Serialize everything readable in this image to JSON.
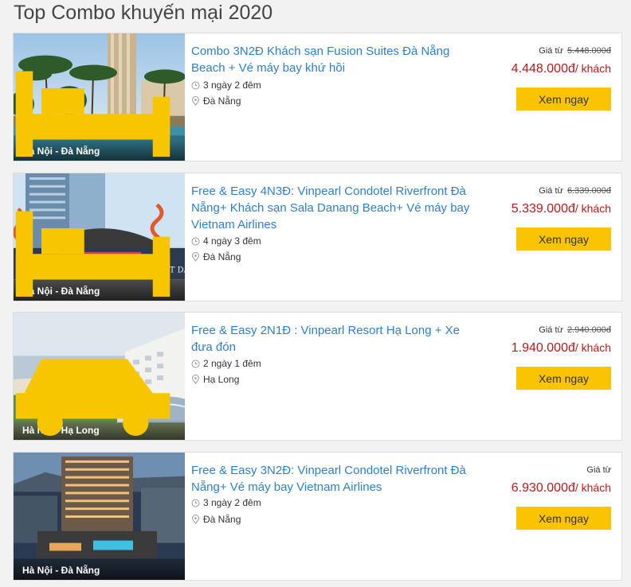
{
  "page": {
    "title": "Top Combo khuyến mại 2020"
  },
  "deals": [
    {
      "title": "Combo 3N2Đ Khách sạn Fusion Suites Đà Nẵng Beach + Vé máy bay khứ hồi",
      "duration": "3 ngày 2 đêm",
      "location": "Đà Nẵng",
      "route": "Hà Nội - Đà Nẵng",
      "price_from_label": "Giá từ",
      "original_price": "5.448.000đ",
      "price": "4.448.000đ",
      "price_unit": "/ khách",
      "button_label": "Xem ngay",
      "transport_icons": [
        "plane-icon",
        "plus-icon",
        "hotel-bed-icon"
      ]
    },
    {
      "title": "Free & Easy 4N3Đ: Vinpearl Condotel Riverfront Đà Nẵng+ Khách sạn Sala Danang Beach+ Vé máy bay Vietnam Airlines",
      "duration": "4 ngày 3 đêm",
      "location": "Đà Nẵng",
      "route": "Hà Nội - Đà Nẵng",
      "price_from_label": "Giá từ",
      "original_price": "6.339.000đ",
      "price": "5.339.000đ",
      "price_unit": "/ khách",
      "button_label": "Xem ngay",
      "transport_icons": [
        "plane-icon",
        "plus-icon",
        "hotel-bed-icon"
      ]
    },
    {
      "title": "Free & Easy 2N1Đ : Vinpearl Resort Hạ Long + Xe đưa đón",
      "duration": "2 ngày 1 đêm",
      "location": "Hạ Long",
      "route": "Hà Nội - Hạ Long",
      "price_from_label": "Giá từ",
      "original_price": "2.940.000đ",
      "price": "1.940.000đ",
      "price_unit": "/ khách",
      "button_label": "Xem ngay",
      "transport_icons": [
        "hotel-bed-icon",
        "plus-icon",
        "car-icon"
      ]
    },
    {
      "title": "Free & Easy 3N2Đ: Vinpearl Condotel Riverfront Đà Nẵng+ Vé máy bay Vietnam Airlines",
      "duration": "3 ngày 2 đêm",
      "location": "Đà Nẵng",
      "route": "Hà Nội - Đà Nẵng",
      "price_from_label": "Giá từ",
      "original_price": "",
      "price": "6.930.000đ",
      "price_unit": "/ khách",
      "button_label": "Xem ngay",
      "transport_icons": [
        "plane-icon",
        "plus-icon",
        "hotel-bed-icon"
      ]
    }
  ],
  "colors": {
    "title_link": "#2f7fc6",
    "price": "#b9191b",
    "button": "#fbc403",
    "transport_icon": "#f7c600"
  }
}
